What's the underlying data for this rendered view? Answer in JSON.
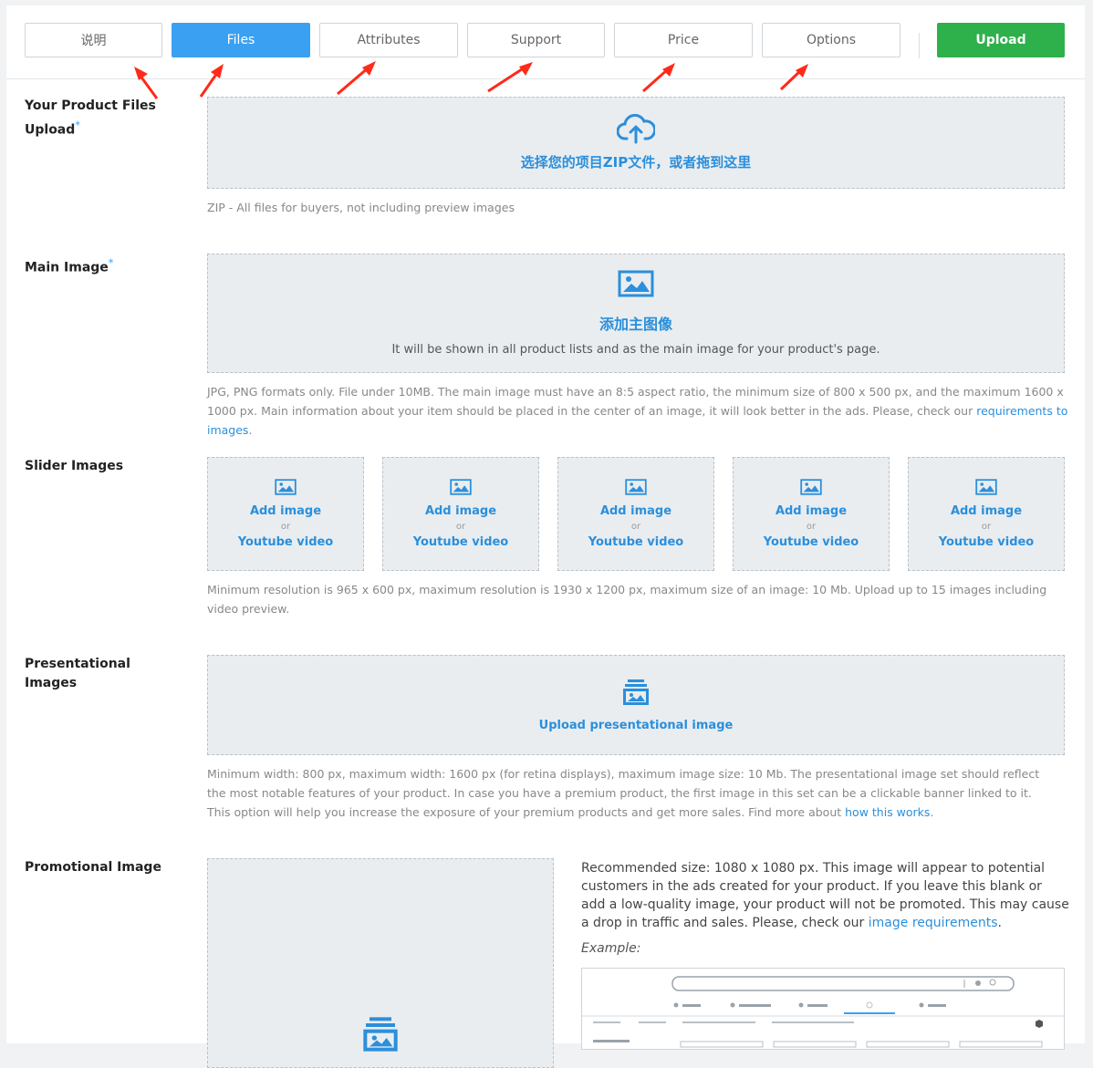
{
  "tabs": [
    {
      "label": "说明"
    },
    {
      "label": "Files"
    },
    {
      "label": "Attributes"
    },
    {
      "label": "Support"
    },
    {
      "label": "Price"
    },
    {
      "label": "Options"
    }
  ],
  "upload_button": "Upload",
  "colors": {
    "accent": "#3aa0f2",
    "upload": "#2eb04b",
    "arrow": "#ff2a1a"
  },
  "product_files": {
    "label": "Your Product Files Upload",
    "required": "*",
    "dropzone_text": "选择您的项目ZIP文件，或者拖到这里",
    "icon": "cloud-upload-icon",
    "help": "ZIP - All files for buyers, not including preview images"
  },
  "main_image": {
    "label": "Main Image",
    "required": "*",
    "title": "添加主图像",
    "subtitle": "It will be shown in all product lists and as the main image for your product's page.",
    "icon": "image-icon",
    "help": "JPG, PNG formats only. File under 10MB. The main image must have an 8:5 aspect ratio, the minimum size of 800 x 500 px, and the maximum 1600 x 1000 px. Main information about your item should be placed in the center of an image, it will look better in the ads. Please, check our ",
    "help_link": "requirements to images",
    "help_end": "."
  },
  "slider_images": {
    "label": "Slider Images",
    "slots": [
      {
        "add": "Add image",
        "or": "or",
        "video": "Youtube video"
      },
      {
        "add": "Add image",
        "or": "or",
        "video": "Youtube video"
      },
      {
        "add": "Add image",
        "or": "or",
        "video": "Youtube video"
      },
      {
        "add": "Add image",
        "or": "or",
        "video": "Youtube video"
      },
      {
        "add": "Add image",
        "or": "or",
        "video": "Youtube video"
      }
    ],
    "help": "Minimum resolution is 965 x 600 px, maximum resolution is 1930 x 1200 px, maximum size of an image: 10 Mb. Upload up to 15 images including video preview."
  },
  "presentational_images": {
    "label": "Presentational Images",
    "button": "Upload presentational image",
    "icon": "image-stack-icon",
    "help": "Minimum width: 800 px, maximum width: 1600 px (for retina displays), maximum image size: 10 Mb. The presentational image set should reflect the most notable features of your product. In case you have a premium product, the first image in this set can be a clickable banner linked to it. This option will help you increase the exposure of your premium products and get more sales. Find more about ",
    "help_link": "how this works",
    "help_end": "."
  },
  "promotional_image": {
    "label": "Promotional Image",
    "text": "Recommended size: 1080 x 1080 px. This image will appear to potential customers in the ads created for your product. If you leave this blank or add a low-quality image, your product will not be promoted. This may cause a drop in traffic and sales. Please, check our ",
    "link": "image requirements",
    "text_end": ".",
    "example_label": "Example:"
  }
}
